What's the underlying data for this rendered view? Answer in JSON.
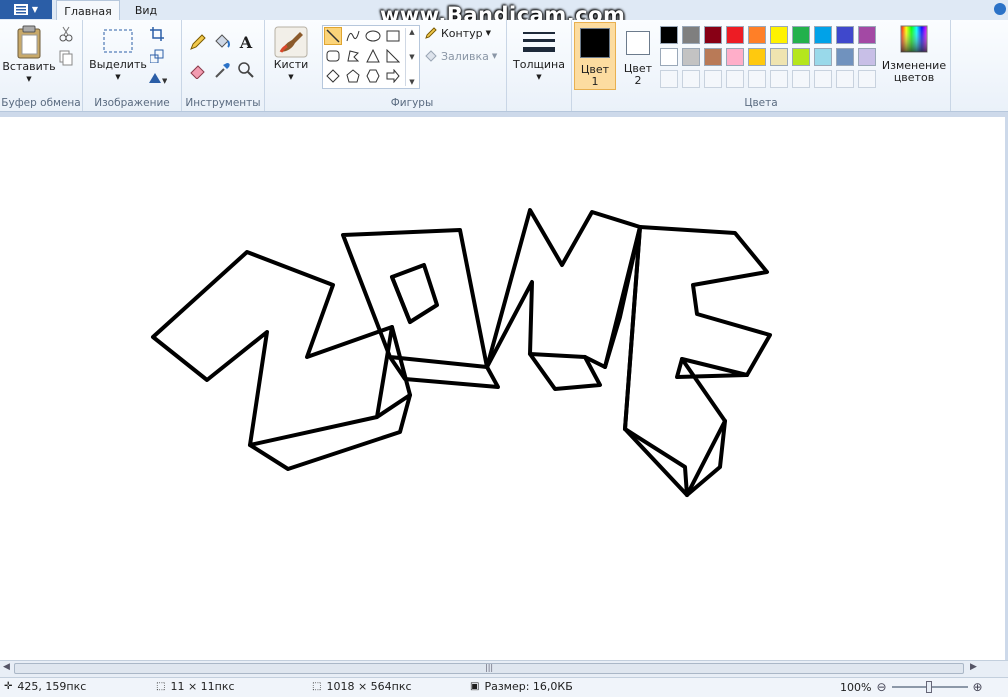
{
  "tabs": {
    "file_icon": "menu-icon",
    "home": "Главная",
    "view": "Вид"
  },
  "watermark": "www.Bandicam.com",
  "clipboard": {
    "paste": "Вставить",
    "label": "Буфер обмена"
  },
  "image": {
    "select": "Выделить",
    "label": "Изображение"
  },
  "tools": {
    "label": "Инструменты",
    "text_tool": "A"
  },
  "brushes": {
    "label": "Кисти"
  },
  "shapes": {
    "outline": "Контур",
    "fill": "Заливка",
    "label": "Фигуры"
  },
  "size": {
    "label": "Толщина"
  },
  "colors": {
    "color1_label": "Цвет 1",
    "color1_line1": "Цвет",
    "color1_line2": "1",
    "color2_line1": "Цвет",
    "color2_line2": "2",
    "edit_line1": "Изменение",
    "edit_line2": "цветов",
    "label": "Цвета",
    "color1": "#000000",
    "color2": "#ffffff",
    "palette_row1": [
      "#000000",
      "#7f7f7f",
      "#880015",
      "#ed1c24",
      "#ff7f27",
      "#fff200",
      "#22b14c",
      "#00a2e8",
      "#3f48cc",
      "#a349a4"
    ],
    "palette_row2": [
      "#ffffff",
      "#c3c3c3",
      "#b97a57",
      "#ffaec9",
      "#ffc90e",
      "#efe4b0",
      "#b5e61d",
      "#99d9ea",
      "#7092be",
      "#c8bfe7"
    ]
  },
  "status": {
    "cursor": "425, 159пкс",
    "selection": "11 × 11пкс",
    "canvas_size": "1018 × 564пкс",
    "file_size": "Размер: 16,0КБ",
    "zoom": "100%"
  }
}
